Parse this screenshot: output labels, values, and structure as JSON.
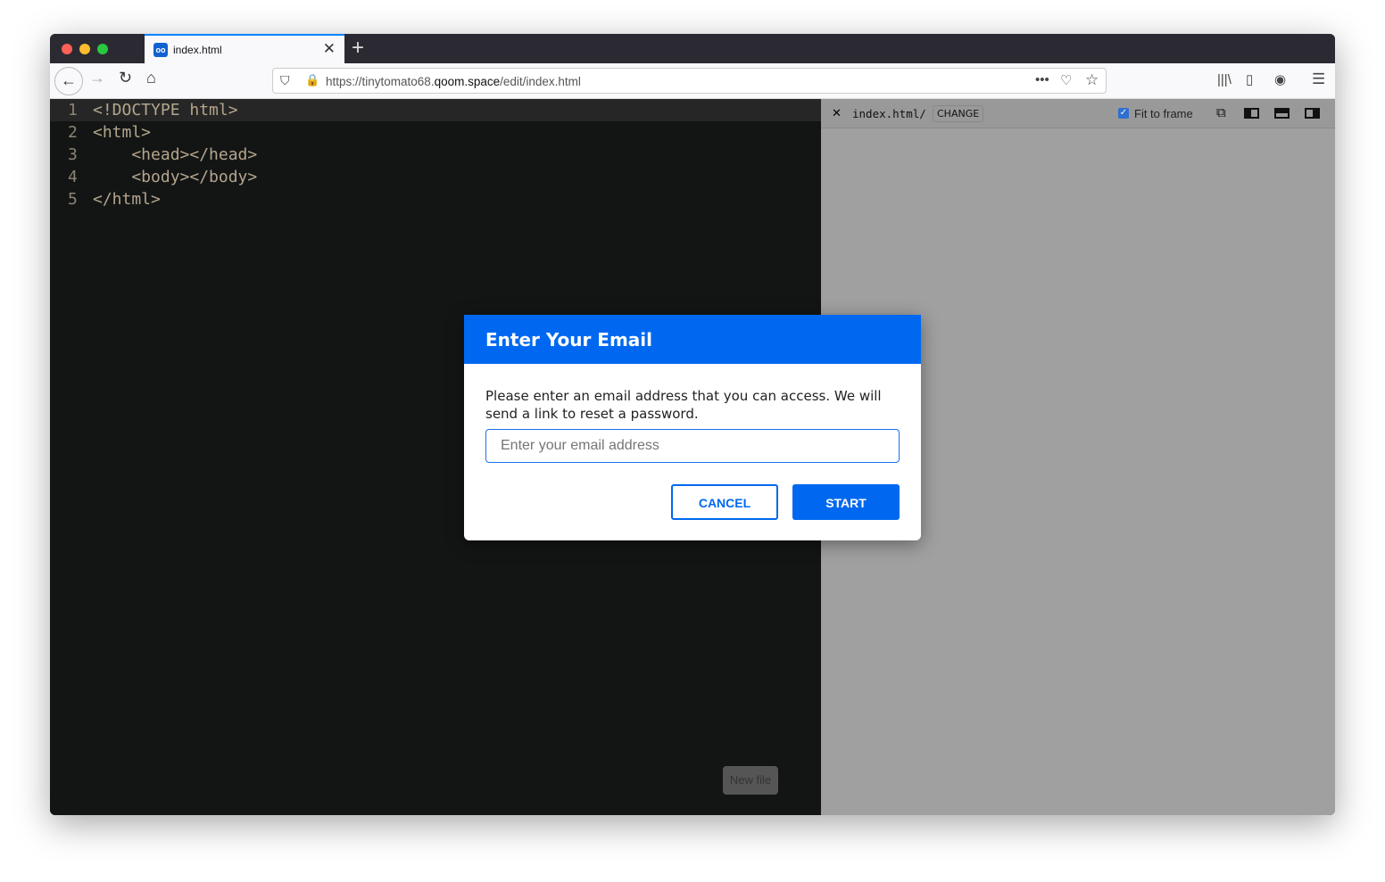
{
  "browser": {
    "tab_title": "index.html",
    "url_prefix": "https://tinytomato68.",
    "url_domain": "qoom.space",
    "url_path": "/edit/index.html"
  },
  "editor": {
    "lines": [
      {
        "n": "1",
        "code": "<!DOCTYPE html>"
      },
      {
        "n": "2",
        "code": "<html>"
      },
      {
        "n": "3",
        "code": "    <head></head>"
      },
      {
        "n": "4",
        "code": "    <body></body>"
      },
      {
        "n": "5",
        "code": "</html>"
      }
    ],
    "new_file": "New file"
  },
  "preview": {
    "path": "index.html/",
    "change": "CHANGE",
    "fit_label": "Fit to frame",
    "fit_checked": true
  },
  "modal": {
    "title": "Enter Your Email",
    "message": "Please enter an email address that you can access. We will send a link to reset a password.",
    "placeholder": "Enter your email address",
    "cancel": "CANCEL",
    "start": "START"
  },
  "colors": {
    "accent": "#0068f0"
  }
}
